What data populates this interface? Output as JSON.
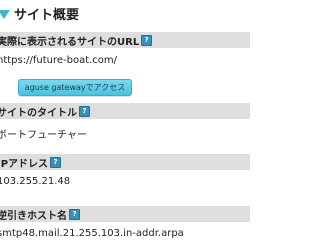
{
  "overview": {
    "title": "サイト概要"
  },
  "url_section": {
    "label": "実際に表示されるサイトのURL",
    "value": "https://future-boat.com/",
    "gateway_button": "aguse gatewayでアクセス"
  },
  "title_section": {
    "label": "サイトのタイトル",
    "value": "ボートフューチャー"
  },
  "ip_section": {
    "label": "IPアドレス",
    "value": "103.255.21.48"
  },
  "reverse_section": {
    "label": "逆引きホスト名",
    "value": "smtp48.mail.21.255.103.in-addr.arpa"
  },
  "help_icon": {
    "glyph": "?"
  },
  "colors": {
    "accent": "#3fb6d4",
    "header_bg": "#dedede",
    "button_bg": "#5fcde6",
    "help_icon": "#3a8fb7"
  }
}
